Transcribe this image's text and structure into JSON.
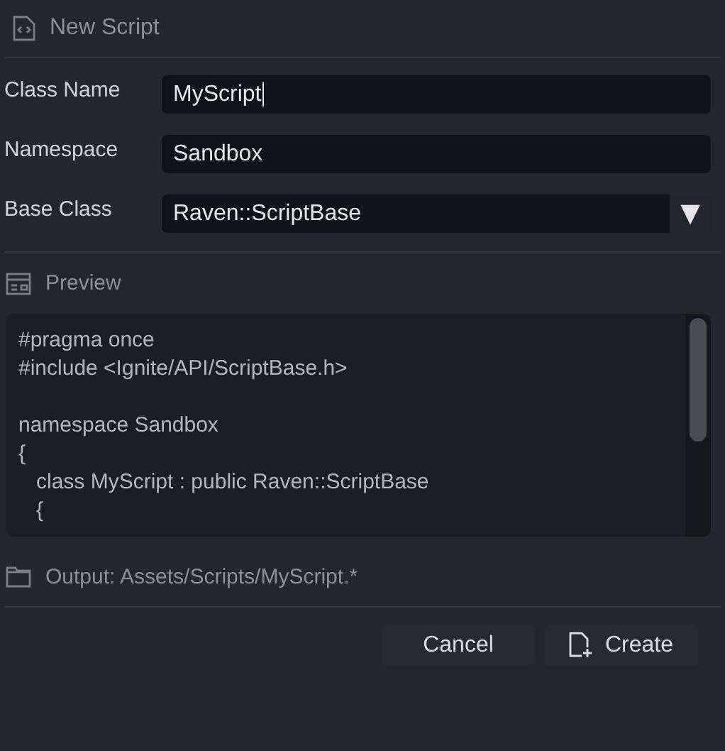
{
  "window": {
    "title": "New Script"
  },
  "fields": [
    {
      "label": "Class Name",
      "value": "MyScript",
      "kind": "text",
      "focused": true
    },
    {
      "label": "Namespace",
      "value": "Sandbox",
      "kind": "text",
      "focused": false
    },
    {
      "label": "Base Class",
      "value": "Raven::ScriptBase",
      "kind": "dropdown",
      "dropdown_arrow": "▼"
    }
  ],
  "preview": {
    "title": "Preview",
    "code": "#pragma once\n#include <Ignite/API/ScriptBase.h>\n\nnamespace Sandbox\n{\n   class MyScript : public Raven::ScriptBase\n   {"
  },
  "output": {
    "text": "Output: Assets/Scripts/MyScript.*"
  },
  "buttons": [
    {
      "label": "Cancel",
      "kind": "plain"
    },
    {
      "label": "Create",
      "kind": "create"
    }
  ]
}
